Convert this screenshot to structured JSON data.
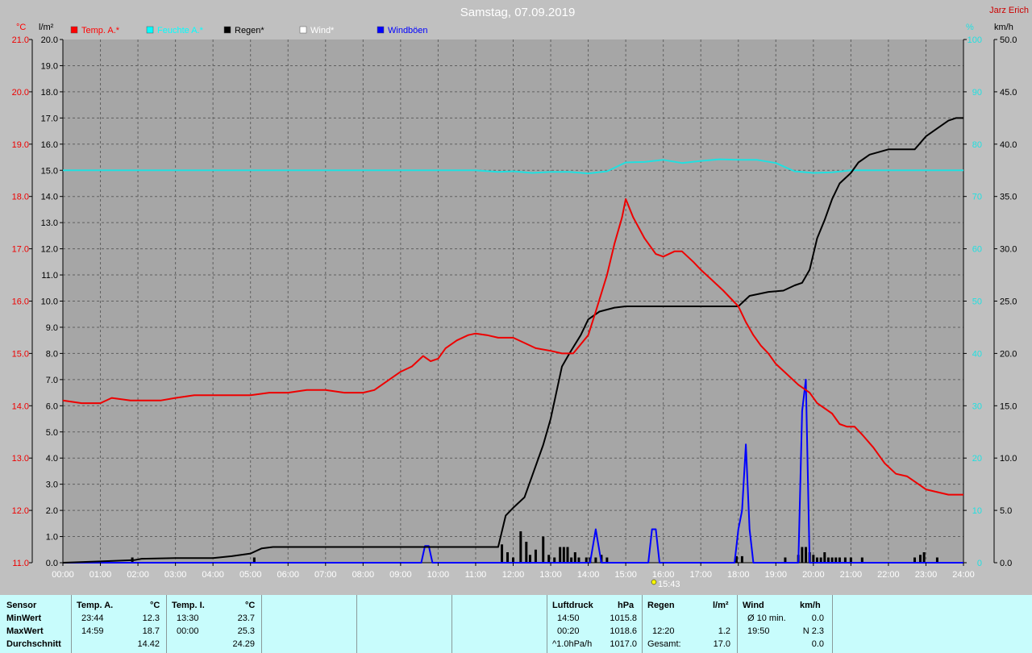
{
  "title": "Samstag, 07.09.2019",
  "author": "Jarz Erich",
  "axes": {
    "left_temp_unit": "°C",
    "left_rain_unit": "l/m²",
    "right_pct_unit": "%",
    "right_wind_unit": "km/h",
    "temp_ticks": [
      "21.0",
      "20.0",
      "19.0",
      "18.0",
      "17.0",
      "16.0",
      "15.0",
      "14.0",
      "13.0",
      "12.0",
      "11.0"
    ],
    "rain_ticks": [
      "20.0",
      "19.0",
      "18.0",
      "17.0",
      "16.0",
      "15.0",
      "14.0",
      "13.0",
      "12.0",
      "11.0",
      "10.0",
      "9.0",
      "8.0",
      "7.0",
      "6.0",
      "5.0",
      "4.0",
      "3.0",
      "2.0",
      "1.0",
      "0.0"
    ],
    "pct_ticks": [
      "100",
      "90",
      "80",
      "70",
      "60",
      "50",
      "40",
      "30",
      "20",
      "10",
      "0"
    ],
    "wind_ticks": [
      "50.0",
      "45.0",
      "40.0",
      "35.0",
      "30.0",
      "25.0",
      "20.0",
      "15.0",
      "10.0",
      "5.0",
      "0.0"
    ],
    "x_ticks": [
      "00:00",
      "01:00",
      "02:00",
      "03:00",
      "04:00",
      "05:00",
      "06:00",
      "07:00",
      "08:00",
      "09:00",
      "10:00",
      "11:00",
      "12:00",
      "13:00",
      "14:00",
      "15:00",
      "16:00",
      "17:00",
      "18:00",
      "19:00",
      "20:00",
      "21:00",
      "22:00",
      "23:00",
      "24:00"
    ],
    "sun_marker": "15:43"
  },
  "legend": [
    {
      "label": "Temp. A.*",
      "color": "#ff0000"
    },
    {
      "label": "Feuchte A.*",
      "color": "#00ffff"
    },
    {
      "label": "Regen*",
      "color": "#000000"
    },
    {
      "label": "Wind*",
      "color": "#ffffff"
    },
    {
      "label": "Windböen",
      "color": "#0000ff"
    }
  ],
  "colors": {
    "temp": "#ee0000",
    "humidity": "#20e0e0",
    "rain": "#000000",
    "gust": "#0000ff",
    "wind": "#ffffff",
    "rain_bars": "#000000"
  },
  "chart_data": {
    "type": "line",
    "title": "Samstag, 07.09.2019",
    "xlim": [
      0,
      24
    ],
    "series": [
      {
        "name": "Temp. A.*",
        "axis": "temp °C",
        "ylim": [
          11,
          21
        ],
        "x": [
          0,
          0.5,
          1,
          1.3,
          1.8,
          2.2,
          2.6,
          3,
          3.5,
          4,
          4.5,
          5,
          5.5,
          6,
          6.5,
          7,
          7.5,
          8,
          8.3,
          8.6,
          9,
          9.3,
          9.6,
          9.8,
          10,
          10.2,
          10.5,
          10.8,
          11,
          11.3,
          11.6,
          12,
          12.3,
          12.6,
          13,
          13.3,
          13.6,
          14,
          14.2,
          14.5,
          14.7,
          14.9,
          15,
          15.2,
          15.5,
          15.8,
          16,
          16.3,
          16.5,
          16.8,
          17,
          17.3,
          17.6,
          18,
          18.2,
          18.4,
          18.6,
          18.8,
          19,
          19.3,
          19.6,
          19.9,
          20.1,
          20.3,
          20.5,
          20.7,
          20.9,
          21.1,
          21.3,
          21.6,
          21.9,
          22.2,
          22.5,
          22.8,
          23,
          23.3,
          23.6,
          23.8,
          24
        ],
        "y": [
          14.1,
          14.05,
          14.05,
          14.15,
          14.1,
          14.1,
          14.1,
          14.15,
          14.2,
          14.2,
          14.2,
          14.2,
          14.25,
          14.25,
          14.3,
          14.3,
          14.25,
          14.25,
          14.3,
          14.45,
          14.65,
          14.75,
          14.95,
          14.85,
          14.9,
          15.1,
          15.25,
          15.35,
          15.38,
          15.35,
          15.3,
          15.3,
          15.2,
          15.1,
          15.05,
          15.0,
          15.0,
          15.35,
          15.8,
          16.5,
          17.1,
          17.6,
          17.95,
          17.6,
          17.2,
          16.9,
          16.85,
          16.95,
          16.95,
          16.75,
          16.6,
          16.4,
          16.2,
          15.9,
          15.6,
          15.35,
          15.15,
          15.0,
          14.8,
          14.6,
          14.4,
          14.25,
          14.05,
          13.95,
          13.85,
          13.65,
          13.6,
          13.6,
          13.45,
          13.2,
          12.9,
          12.7,
          12.65,
          12.5,
          12.4,
          12.35,
          12.3,
          12.3,
          12.3
        ]
      },
      {
        "name": "Feuchte A.*",
        "axis": "%",
        "ylim": [
          0,
          100
        ],
        "x": [
          0,
          3,
          6,
          9,
          11,
          11.6,
          12,
          12.5,
          13,
          13.5,
          14,
          14.5,
          15,
          15.5,
          16,
          16.5,
          17,
          17.5,
          18,
          18.5,
          19,
          19.5,
          20,
          20.5,
          21,
          22,
          23,
          24
        ],
        "y": [
          75,
          75,
          75,
          75,
          75,
          74.7,
          74.8,
          74.5,
          74.7,
          74.7,
          74.4,
          74.8,
          76.5,
          76.6,
          77.0,
          76.4,
          76.8,
          77.1,
          77.0,
          77.0,
          76.4,
          74.8,
          74.5,
          74.6,
          75,
          75,
          75,
          75
        ]
      },
      {
        "name": "Regen*",
        "axis": "l/m²",
        "ylim": [
          0,
          20
        ],
        "x": [
          0,
          1.9,
          2.1,
          3,
          4,
          4.5,
          5,
          5.3,
          5.6,
          6,
          7,
          8,
          9,
          10,
          11,
          11.6,
          11.8,
          12,
          12.3,
          12.5,
          12.8,
          13,
          13.3,
          13.5,
          13.8,
          14,
          14.3,
          14.7,
          15,
          15.5,
          16,
          16.5,
          17,
          17.5,
          18,
          18.3,
          18.8,
          19.2,
          19.5,
          19.7,
          19.9,
          20.1,
          20.3,
          20.5,
          20.7,
          21,
          21.2,
          21.5,
          22,
          22.5,
          22.7,
          23,
          23.3,
          23.6,
          23.8,
          24
        ],
        "y": [
          0,
          0.1,
          0.15,
          0.18,
          0.18,
          0.25,
          0.35,
          0.55,
          0.6,
          0.6,
          0.6,
          0.6,
          0.6,
          0.6,
          0.6,
          0.6,
          1.8,
          2.1,
          2.5,
          3.3,
          4.5,
          5.5,
          7.5,
          8,
          8.7,
          9.3,
          9.6,
          9.75,
          9.8,
          9.8,
          9.8,
          9.8,
          9.8,
          9.8,
          9.8,
          10.2,
          10.35,
          10.4,
          10.6,
          10.7,
          11.2,
          12.4,
          13.1,
          13.9,
          14.5,
          14.9,
          15.3,
          15.6,
          15.8,
          15.8,
          15.8,
          16.3,
          16.6,
          16.9,
          17.0,
          17.0
        ]
      },
      {
        "name": "Windböen",
        "axis": "km/h",
        "ylim": [
          0,
          50
        ],
        "x": [
          0,
          9.55,
          9.65,
          9.75,
          9.85,
          14.05,
          14.2,
          14.35,
          15.6,
          15.7,
          15.8,
          15.9,
          17.9,
          18.0,
          18.1,
          18.2,
          18.3,
          18.4,
          19.6,
          19.7,
          19.8,
          19.9,
          20.0,
          24
        ],
        "y": [
          0,
          0,
          1.6,
          1.6,
          0,
          0,
          3.2,
          0,
          0,
          3.2,
          3.2,
          0,
          0,
          3.2,
          5,
          11.3,
          3.2,
          0,
          0,
          14.5,
          17.5,
          0,
          0,
          0
        ]
      }
    ],
    "rain_bars": {
      "x": [
        1.85,
        5.1,
        11.7,
        11.85,
        12.0,
        12.2,
        12.35,
        12.45,
        12.6,
        12.8,
        12.95,
        13.1,
        13.25,
        13.35,
        13.45,
        13.55,
        13.65,
        13.75,
        13.95,
        14.05,
        14.2,
        14.35,
        14.5,
        17.95,
        18.1,
        19.25,
        19.6,
        19.7,
        19.8,
        19.9,
        20.0,
        20.1,
        20.2,
        20.3,
        20.4,
        20.5,
        20.6,
        20.7,
        20.85,
        21.0,
        21.3,
        22.7,
        22.85,
        22.95,
        23.3
      ],
      "y": [
        0.2,
        0.2,
        0.7,
        0.4,
        0.2,
        1.2,
        0.8,
        0.3,
        0.5,
        1.0,
        0.3,
        0.2,
        0.6,
        0.6,
        0.6,
        0.2,
        0.4,
        0.2,
        0.2,
        0.2,
        0.2,
        0.3,
        0.2,
        0.25,
        0.25,
        0.2,
        0.3,
        0.6,
        0.6,
        0.4,
        0.3,
        0.2,
        0.2,
        0.4,
        0.2,
        0.2,
        0.2,
        0.2,
        0.2,
        0.2,
        0.2,
        0.2,
        0.3,
        0.4,
        0.2
      ]
    }
  },
  "stats": {
    "temp_a": {
      "headers": {
        "sensor": "Sensor",
        "label": "Temp. A.",
        "unit": "°C"
      },
      "rows": [
        {
          "label": "MinWert",
          "time": "23:44",
          "value": "12.3"
        },
        {
          "label": "MaxWert",
          "time": "14:59",
          "value": "18.7"
        },
        {
          "label": "Durchschnitt",
          "time": "",
          "value": "14.42"
        }
      ]
    },
    "temp_i": {
      "headers": {
        "label": "Temp. I.",
        "unit": "°C"
      },
      "rows": [
        {
          "time": "13:30",
          "value": "23.7"
        },
        {
          "time": "00:00",
          "value": "25.3"
        },
        {
          "time": "",
          "value": "24.29"
        }
      ]
    },
    "pressure": {
      "headers": {
        "label": "Luftdruck",
        "unit": "hPa"
      },
      "rows": [
        {
          "time": "14:50",
          "value": "1015.8"
        },
        {
          "time": "00:20",
          "value": "1018.6"
        },
        {
          "time": "^1.0hPa/h",
          "value": "1017.0"
        }
      ]
    },
    "rain": {
      "headers": {
        "label": "Regen",
        "unit": "l/m²"
      },
      "rows": [
        {
          "time": "",
          "value": ""
        },
        {
          "time": "12:20",
          "value": "1.2"
        },
        {
          "time": "Gesamt:",
          "value": "17.0"
        }
      ]
    },
    "wind": {
      "headers": {
        "label": "Wind",
        "unit": "km/h"
      },
      "rows": [
        {
          "time": "Ø 10 min.",
          "value": "0.0"
        },
        {
          "time": "19:50",
          "value": "N 2.3"
        },
        {
          "time": "",
          "value": "0.0"
        }
      ]
    }
  }
}
